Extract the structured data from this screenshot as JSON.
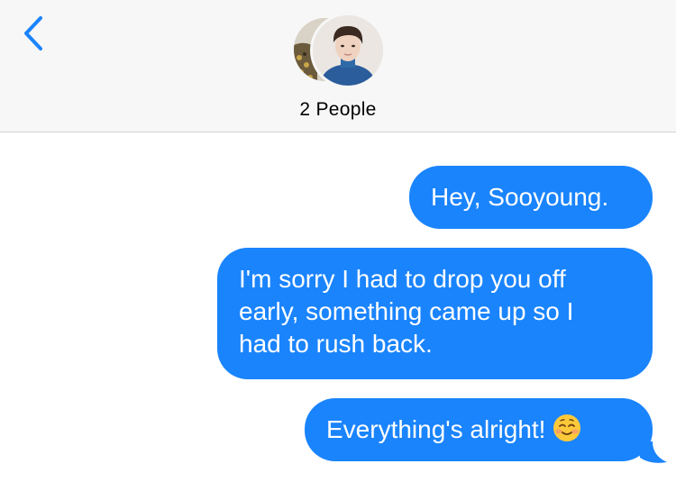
{
  "header": {
    "back_label": "Back",
    "title": "2 People",
    "avatars": [
      {
        "icon": "person-photo-avatar",
        "color": "#cfc6b8"
      },
      {
        "icon": "person-photo-avatar",
        "color": "#2d5fa0"
      }
    ]
  },
  "messages": [
    {
      "text": "Hey, Sooyoung."
    },
    {
      "text": "I'm sorry I had to drop you off\nearly, something came up so I\nhad to rush back."
    },
    {
      "text": "Everything's alright!",
      "emoji": "smiling-face-icon"
    }
  ],
  "colors": {
    "accent": "#1a84fd",
    "header_bg": "#f7f7f7",
    "divider": "#d4d4d6"
  }
}
